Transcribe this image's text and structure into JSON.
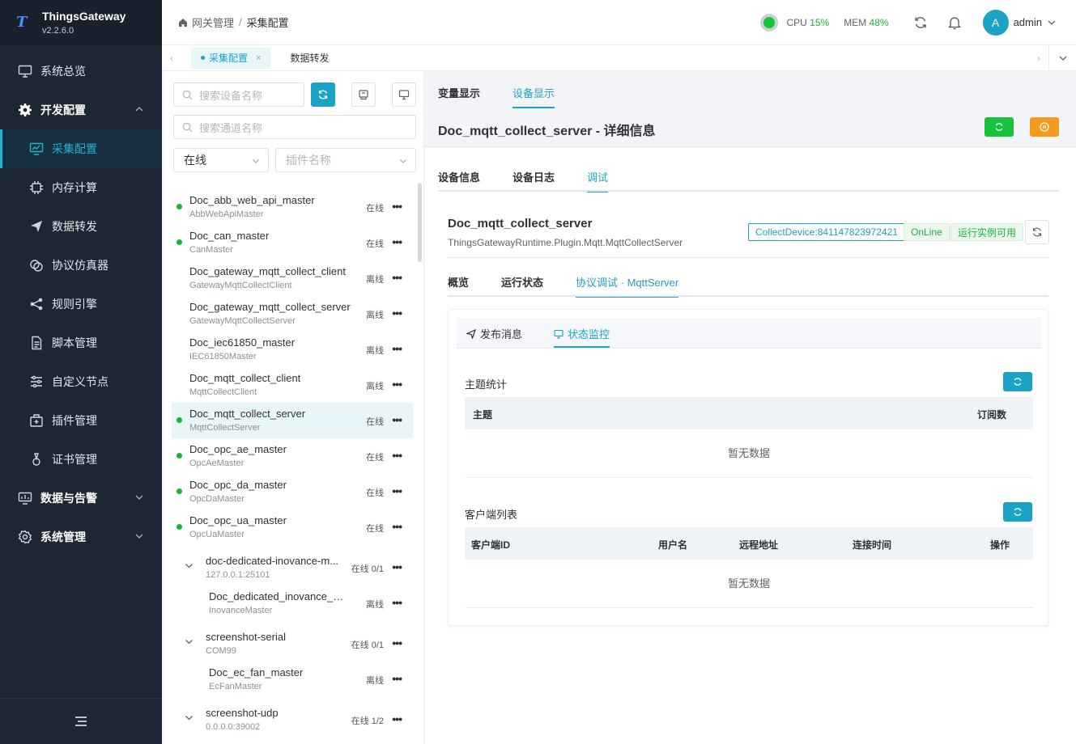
{
  "app": {
    "name": "ThingsGateway",
    "version": "v2.2.6.0",
    "logo_letter": "T"
  },
  "sidebar": {
    "items": [
      {
        "label": "系统总览",
        "icon": "monitor-icon"
      },
      {
        "label": "开发配置",
        "icon": "gear-icon"
      },
      {
        "label": "采集配置",
        "icon": "chart-monitor-icon"
      },
      {
        "label": "内存计算",
        "icon": "chip-icon"
      },
      {
        "label": "数据转发",
        "icon": "send-icon"
      },
      {
        "label": "协议仿真器",
        "icon": "link-icon"
      },
      {
        "label": "规则引擎",
        "icon": "share-icon"
      },
      {
        "label": "脚本管理",
        "icon": "file-icon"
      },
      {
        "label": "自定义节点",
        "icon": "sliders-icon"
      },
      {
        "label": "插件管理",
        "icon": "box-icon"
      },
      {
        "label": "证书管理",
        "icon": "ring-icon"
      },
      {
        "label": "数据与告警",
        "icon": "monitor-chart-icon"
      },
      {
        "label": "系统管理",
        "icon": "cog-icon"
      }
    ]
  },
  "header": {
    "breadcrumb": [
      "网关管理",
      "采集配置"
    ],
    "cpu_label": "CPU",
    "cpu_value": "15%",
    "mem_label": "MEM",
    "mem_value": "48%",
    "avatar_letter": "A",
    "user": "admin"
  },
  "page_tabs": [
    {
      "label": "采集配置",
      "close": "×"
    },
    {
      "label": "数据转发"
    }
  ],
  "filters": {
    "device_search_placeholder": "搜索设备名称",
    "channel_search_placeholder": "搜索通道名称",
    "status_value": "在线",
    "plugin_placeholder": "插件名称"
  },
  "devices": [
    {
      "name": "Doc_abb_web_api_master",
      "plugin": "AbbWebApiMaster",
      "status": "在线"
    },
    {
      "name": "Doc_can_master",
      "plugin": "CanMaster",
      "status": "在线"
    },
    {
      "name": "Doc_gateway_mqtt_collect_client",
      "plugin": "GatewayMqttCollectClient",
      "status": "离线"
    },
    {
      "name": "Doc_gateway_mqtt_collect_server",
      "plugin": "GatewayMqttCollectServer",
      "status": "离线"
    },
    {
      "name": "Doc_iec61850_master",
      "plugin": "IEC61850Master",
      "status": "离线"
    },
    {
      "name": "Doc_mqtt_collect_client",
      "plugin": "MqttCollectClient",
      "status": "离线"
    },
    {
      "name": "Doc_mqtt_collect_server",
      "plugin": "MqttCollectServer",
      "status": "在线"
    },
    {
      "name": "Doc_opc_ae_master",
      "plugin": "OpcAeMaster",
      "status": "在线"
    },
    {
      "name": "Doc_opc_da_master",
      "plugin": "OpcDaMaster",
      "status": "在线"
    },
    {
      "name": "Doc_opc_ua_master",
      "plugin": "OpcUaMaster",
      "status": "在线"
    },
    {
      "name": "doc-dedicated-inovance-m...",
      "plugin": "127.0.0.1:25101",
      "status": "在线 0/1"
    },
    {
      "name": "Doc_dedicated_inovance_ma...",
      "plugin": "InovanceMaster",
      "status": "离线"
    },
    {
      "name": "screenshot-serial",
      "plugin": "COM99",
      "status": "在线 0/1"
    },
    {
      "name": "Doc_ec_fan_master",
      "plugin": "EcFanMaster",
      "status": "离线"
    },
    {
      "name": "screenshot-udp",
      "plugin": "0.0.0.0:39002",
      "status": "在线 1/2"
    }
  ],
  "more_glyph": "•••",
  "main": {
    "view_tabs": [
      "变量显示",
      "设备显示"
    ],
    "detail_title": "Doc_mqtt_collect_server - 详细信息",
    "detail_tabs": [
      "设备信息",
      "设备日志",
      "调试"
    ],
    "device_name": "Doc_mqtt_collect_server",
    "device_class": "ThingsGatewayRuntime.Plugin.Mqtt.MqttCollectServer",
    "tags": [
      "CollectDevice:841147823972421",
      "OnLine",
      "运行实例可用"
    ],
    "debug_tabs": [
      "概览",
      "运行状态",
      "协议调试 · MqttServer"
    ],
    "sub_tabs": [
      "发布消息",
      "状态监控"
    ],
    "topic_section": {
      "title": "主题统计",
      "columns": [
        "主题",
        "订阅数"
      ],
      "empty": "暂无数据"
    },
    "client_section": {
      "title": "客户端列表",
      "columns": [
        "客户端ID",
        "用户名",
        "远程地址",
        "连接时间",
        "操作"
      ],
      "empty": "暂无数据"
    }
  },
  "colors": {
    "accent": "#1aa3c4",
    "online": "#19b33a",
    "sidebar": "#1d2733",
    "orange": "#f29b1c"
  }
}
